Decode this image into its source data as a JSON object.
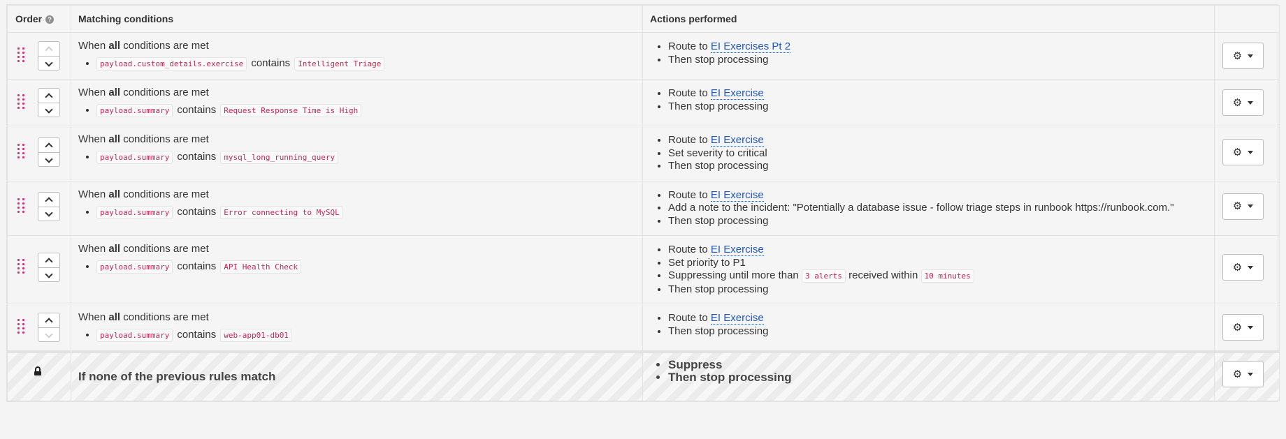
{
  "header": {
    "order_label": "Order",
    "help_icon": "question-circle-icon",
    "conditions_label": "Matching conditions",
    "actions_label": "Actions performed"
  },
  "rules": [
    {
      "when": "When",
      "quantifier": "all",
      "suffix": "conditions are met",
      "field": "payload.custom_details.exercise",
      "operator": "contains",
      "value": "Intelligent Triage",
      "up_disabled": true,
      "down_disabled": false,
      "route_prefix": "Route to",
      "route_link": "EI Exercises Pt 2",
      "extra": [],
      "stop": "Then stop processing"
    },
    {
      "when": "When",
      "quantifier": "all",
      "suffix": "conditions are met",
      "field": "payload.summary",
      "operator": "contains",
      "value": "Request Response Time is High",
      "up_disabled": false,
      "down_disabled": false,
      "route_prefix": "Route to",
      "route_link": "EI Exercise",
      "extra": [],
      "stop": "Then stop processing"
    },
    {
      "when": "When",
      "quantifier": "all",
      "suffix": "conditions are met",
      "field": "payload.summary",
      "operator": "contains",
      "value": "mysql_long_running_query",
      "up_disabled": false,
      "down_disabled": false,
      "route_prefix": "Route to",
      "route_link": "EI Exercise",
      "extra": [
        "Set severity to critical"
      ],
      "stop": "Then stop processing"
    },
    {
      "when": "When",
      "quantifier": "all",
      "suffix": "conditions are met",
      "field": "payload.summary",
      "operator": "contains",
      "value": "Error connecting to MySQL",
      "up_disabled": false,
      "down_disabled": false,
      "route_prefix": "Route to",
      "route_link": "EI Exercise",
      "extra": [
        "Add a note to the incident: \"Potentially a database issue - follow triage steps in runbook https://runbook.com.\""
      ],
      "stop": "Then stop processing"
    },
    {
      "when": "When",
      "quantifier": "all",
      "suffix": "conditions are met",
      "field": "payload.summary",
      "operator": "contains",
      "value": "API Health Check",
      "up_disabled": false,
      "down_disabled": false,
      "route_prefix": "Route to",
      "route_link": "EI Exercise",
      "extra": [
        "Set priority to P1"
      ],
      "suppress": {
        "prefix": "Suppressing until more than",
        "count": "3 alerts",
        "middle": "received within",
        "window": "10 minutes"
      },
      "stop": "Then stop processing"
    },
    {
      "when": "When",
      "quantifier": "all",
      "suffix": "conditions are met",
      "field": "payload.summary",
      "operator": "contains",
      "value": "web-app01-db01",
      "up_disabled": false,
      "down_disabled": true,
      "route_prefix": "Route to",
      "route_link": "EI Exercise",
      "extra": [],
      "stop": "Then stop processing"
    }
  ],
  "fallback": {
    "lock_icon": "lock-icon",
    "title": "If none of the previous rules match",
    "actions": [
      "Suppress",
      "Then stop processing"
    ]
  },
  "icons": {
    "drag": "drag-handle-icon",
    "gear": "gear-icon",
    "caret": "caret-down-icon"
  },
  "colors": {
    "link": "#1f56c4",
    "code": "#c7254e",
    "drag": "#d8317a"
  }
}
